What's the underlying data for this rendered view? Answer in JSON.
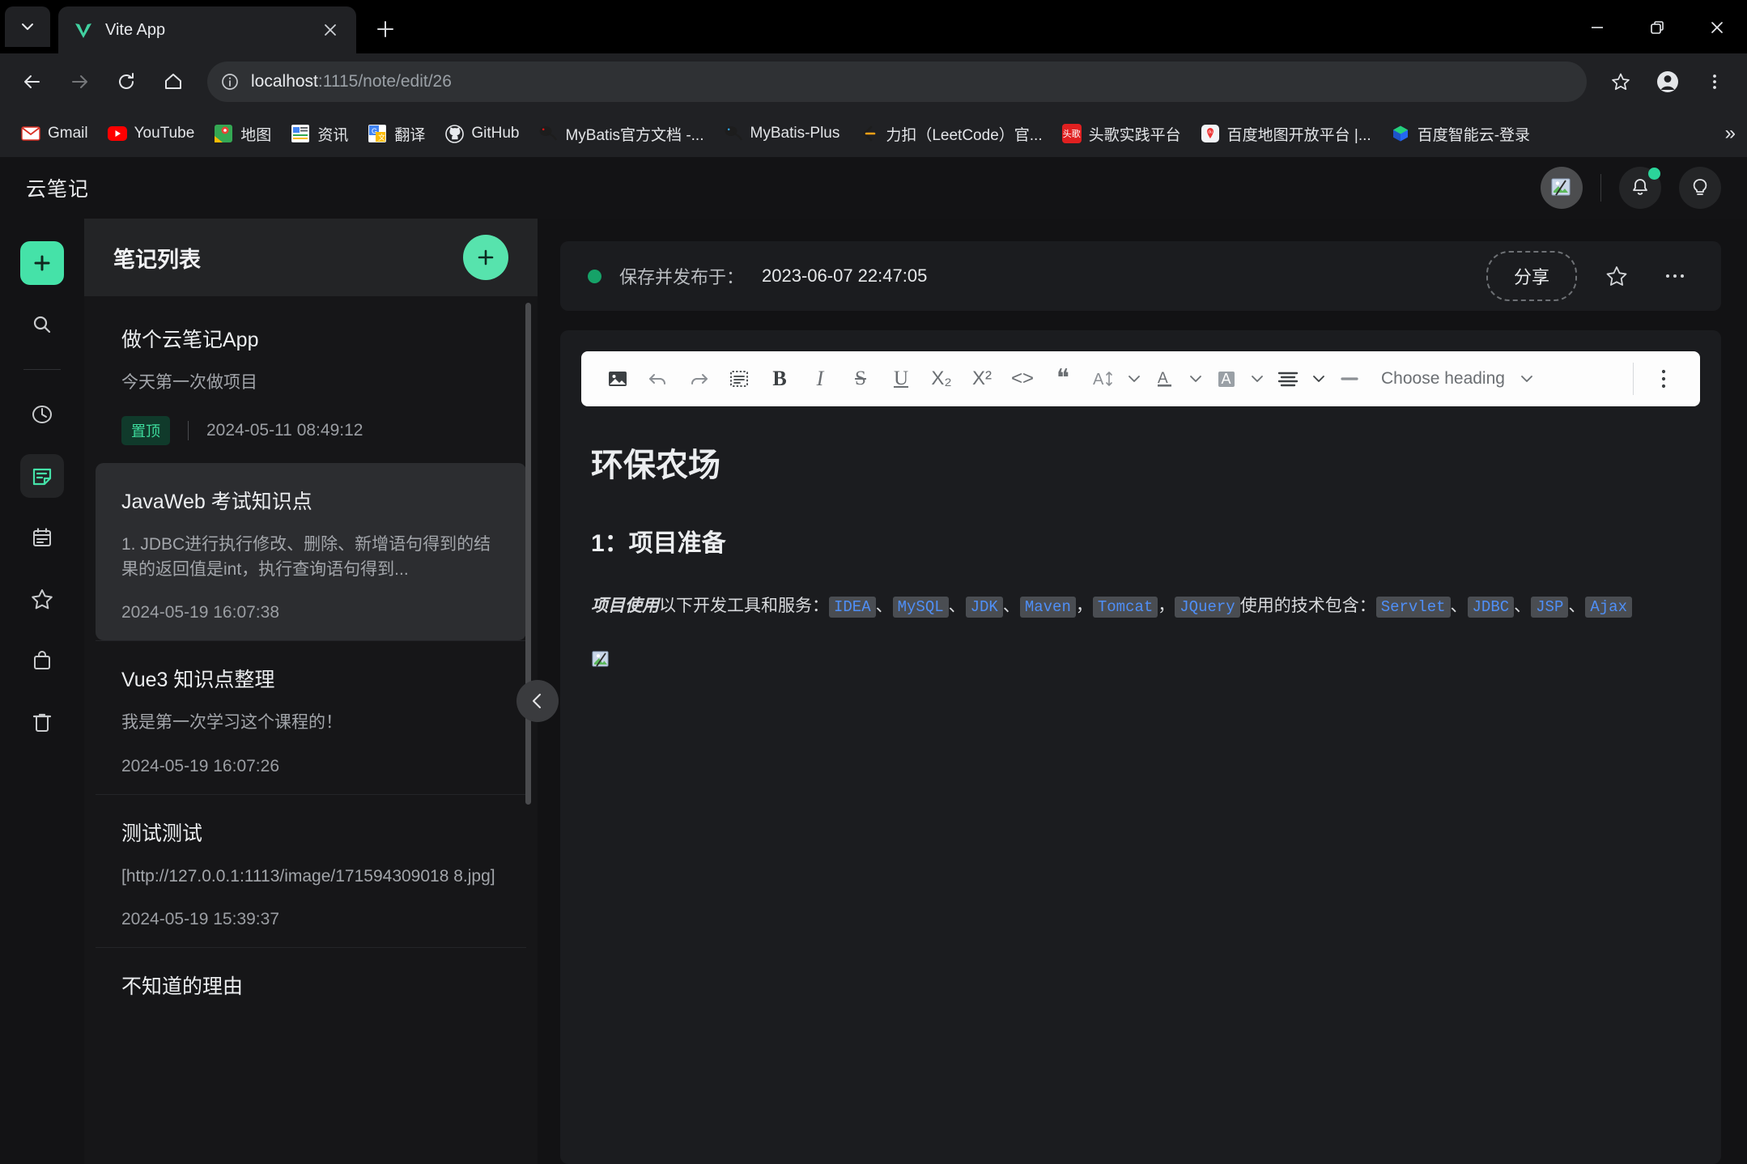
{
  "browser": {
    "tab": {
      "title": "Vite App",
      "favicon": "vite-logo-icon"
    },
    "new_tab_label": "+",
    "window": {
      "minimize": "–",
      "maximize": "❐",
      "close": "✕"
    },
    "nav": {
      "back": "back-arrow-icon",
      "forward": "forward-arrow-icon",
      "reload": "reload-icon",
      "home": "home-icon"
    },
    "omnibox": {
      "info_icon": "site-info-icon",
      "url_host": "localhost",
      "url_path": ":1115/note/edit/26",
      "bookmark_star": "star-icon",
      "profile": "profile-icon",
      "menu": "kebab-menu-icon"
    },
    "bookmarks": [
      {
        "label": "Gmail",
        "icon": "gmail-icon",
        "color": "#d93025"
      },
      {
        "label": "YouTube",
        "icon": "youtube-icon",
        "color": "#ff0000"
      },
      {
        "label": "地图",
        "icon": "google-maps-icon",
        "color": "#34a853"
      },
      {
        "label": "资讯",
        "icon": "google-news-icon",
        "color": "#1a73e8"
      },
      {
        "label": "翻译",
        "icon": "google-translate-icon",
        "color": "#4285f4"
      },
      {
        "label": "GitHub",
        "icon": "github-icon",
        "color": "#e8eaed"
      },
      {
        "label": "MyBatis官方文档 -...",
        "icon": "mybatis-icon",
        "color": "#cc2127"
      },
      {
        "label": "MyBatis-Plus",
        "icon": "mybatis-plus-icon",
        "color": "#2f9fe0"
      },
      {
        "label": "力扣（LeetCode）官...",
        "icon": "leetcode-icon",
        "color": "#ffa116"
      },
      {
        "label": "头歌实践平台",
        "icon": "touge-icon",
        "color": "#e02020"
      },
      {
        "label": "百度地图开放平台 |...",
        "icon": "baidu-map-icon",
        "color": "#2e7de1"
      },
      {
        "label": "百度智能云-登录",
        "icon": "baidu-cloud-icon",
        "color": "#2468f2"
      }
    ],
    "bookmarks_overflow": "»"
  },
  "app": {
    "brand": "云笔记",
    "header": {
      "avatar": "broken-image-avatar",
      "notifications_icon": "bell-icon",
      "notifications_badge": true,
      "tips_icon": "lightbulb-icon"
    },
    "rail": [
      {
        "name": "add",
        "icon": "plus-icon",
        "style": "accent"
      },
      {
        "name": "search",
        "icon": "search-icon",
        "style": "plain"
      },
      {
        "name": "separator",
        "icon": "divider",
        "style": "divider"
      },
      {
        "name": "history",
        "icon": "clock-icon",
        "style": "plain"
      },
      {
        "name": "notes",
        "icon": "note-icon",
        "style": "active"
      },
      {
        "name": "calendar",
        "icon": "calendar-icon",
        "style": "plain"
      },
      {
        "name": "favorites",
        "icon": "star-icon",
        "style": "plain"
      },
      {
        "name": "store",
        "icon": "bag-icon",
        "style": "plain"
      },
      {
        "name": "trash",
        "icon": "trash-icon",
        "style": "plain"
      }
    ],
    "notelist": {
      "title": "笔记列表",
      "add_label": "+",
      "collapse_icon": "chevron-left-icon",
      "items": [
        {
          "title": "做个云笔记App",
          "snippet": "今天第一次做项目",
          "pinned_label": "置顶",
          "date": "2024-05-11 08:49:12",
          "selected": false
        },
        {
          "title": "JavaWeb 考试知识点",
          "snippet": "1. JDBC进行执行修改、删除、新增语句得到的结果的返回值是int，执行查询语句得到...",
          "pinned_label": "",
          "date": "2024-05-19 16:07:38",
          "selected": true
        },
        {
          "title": "Vue3 知识点整理",
          "snippet": "我是第一次学习这个课程的！",
          "pinned_label": "",
          "date": "2024-05-19 16:07:26",
          "selected": false
        },
        {
          "title": "测试测试",
          "snippet": "[http://127.0.0.1:1113/image/171594309018 8.jpg]",
          "pinned_label": "",
          "date": "2024-05-19 15:39:37",
          "selected": false
        },
        {
          "title": "不知道的理由",
          "snippet": "",
          "pinned_label": "",
          "date": "",
          "selected": false
        }
      ]
    },
    "editor": {
      "status_prefix": "保存并发布于：",
      "status_date": "2023-06-07 22:47:05",
      "status_dot_color": "#16a268",
      "share_label": "分享",
      "favorite_icon": "star-icon",
      "more_icon": "ellipsis-icon",
      "toolbar": {
        "image": "image-icon",
        "undo": "undo-icon",
        "redo": "redo-icon",
        "clear_format": "clear-format-icon",
        "bold": "B",
        "italic": "I",
        "strike": "S",
        "underline": "U",
        "subscript": "X₂",
        "superscript": "X²",
        "code": "<>",
        "quote": "❝",
        "font_size": "font-size-icon",
        "text_color": "text-color-icon",
        "highlight": "highlight-icon",
        "align": "align-icon",
        "hr": "horizontal-rule-icon",
        "heading_label": "Choose heading",
        "heading_caret": "chevron-down-icon",
        "more": "vertical-ellipsis-icon"
      },
      "document": {
        "h1": "环保农场",
        "h2": "1：项目准备",
        "paragraph_lead_bold": "项目使用",
        "paragraph_lead_rest": "以下开发工具和服务：",
        "tools": [
          "IDEA",
          "MySQL",
          "JDK",
          "Maven",
          "Tomcat",
          "JQuery"
        ],
        "tools_separators": [
          "、",
          "、",
          "、",
          "，",
          "，"
        ],
        "mid_text": "使用的技术包含：",
        "techs": [
          "Servlet",
          "JDBC",
          "JSP",
          "Ajax"
        ],
        "techs_separators": [
          "、",
          "、",
          "、"
        ],
        "broken_image": "broken-image-icon"
      }
    }
  }
}
